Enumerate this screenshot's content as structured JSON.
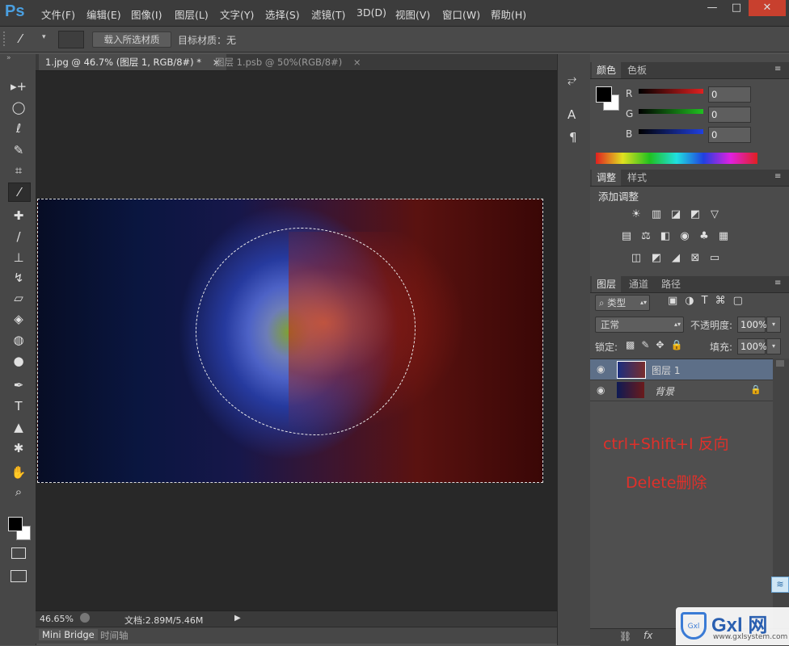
{
  "app": {
    "logo": "Ps"
  },
  "menubar": {
    "items": [
      "文件(F)",
      "编辑(E)",
      "图像(I)",
      "图层(L)",
      "文字(Y)",
      "选择(S)",
      "滤镜(T)",
      "3D(D)",
      "视图(V)",
      "窗口(W)",
      "帮助(H)"
    ],
    "minimize": "—",
    "maximize": "□",
    "close": "✕"
  },
  "options": {
    "load_button": "载入所选材质",
    "target_label": "目标材质：无"
  },
  "tools": [
    {
      "name": "move-tool-icon",
      "glyph": "▸+"
    },
    {
      "name": "ellipse-marquee-tool-icon",
      "glyph": "◯"
    },
    {
      "name": "lasso-tool-icon",
      "glyph": "ℓ"
    },
    {
      "name": "quick-selection-tool-icon",
      "glyph": "✎"
    },
    {
      "name": "crop-tool-icon",
      "glyph": "⌗"
    },
    {
      "name": "eyedropper-3d-tool-icon",
      "glyph": "⁄"
    },
    {
      "name": "healing-brush-tool-icon",
      "glyph": "✚"
    },
    {
      "name": "brush-tool-icon",
      "glyph": "/"
    },
    {
      "name": "clone-stamp-tool-icon",
      "glyph": "⊥"
    },
    {
      "name": "history-brush-tool-icon",
      "glyph": "↯"
    },
    {
      "name": "eraser-tool-icon",
      "glyph": "▱"
    },
    {
      "name": "paint-bucket-tool-icon",
      "glyph": "◈"
    },
    {
      "name": "blur-tool-icon",
      "glyph": "◍"
    },
    {
      "name": "dodge-tool-icon",
      "glyph": "●"
    },
    {
      "name": "pen-tool-icon",
      "glyph": "✒"
    },
    {
      "name": "type-tool-icon",
      "glyph": "T"
    },
    {
      "name": "path-selection-tool-icon",
      "glyph": "▲"
    },
    {
      "name": "custom-shape-tool-icon",
      "glyph": "✱"
    },
    {
      "name": "hand-tool-icon",
      "glyph": "✋"
    },
    {
      "name": "zoom-tool-icon",
      "glyph": "⌕"
    }
  ],
  "document": {
    "tabs": [
      {
        "label": "1.jpg @ 46.7% (图层 1, RGB/8#) *",
        "close": "×"
      },
      {
        "label": "图层 1.psb @ 50%(RGB/8#)",
        "close": "×"
      }
    ],
    "zoom": "46.65%",
    "doc_info": "文档:2.89M/5.46M"
  },
  "bottom_tabs": [
    "Mini Bridge",
    "时间轴"
  ],
  "color_panel": {
    "tabs": [
      "颜色",
      "色板"
    ],
    "channels": [
      {
        "label": "R",
        "value": "0",
        "color": "#e02020"
      },
      {
        "label": "G",
        "value": "0",
        "color": "#20c020"
      },
      {
        "label": "B",
        "value": "0",
        "color": "#2040e0"
      }
    ]
  },
  "adjust_panel": {
    "tabs": [
      "调整",
      "样式"
    ],
    "heading": "添加调整",
    "row1": [
      "☀",
      "▥",
      "◪",
      "◩",
      "▽"
    ],
    "row2": [
      "▤",
      "⚖",
      "◧",
      "◉",
      "♣",
      "▦"
    ],
    "row3": [
      "◫",
      "◩",
      "◢",
      "⊠",
      "▭"
    ]
  },
  "layers_panel": {
    "tabs": [
      "图层",
      "通道",
      "路径"
    ],
    "filter_kind": "类型",
    "blend_mode": "正常",
    "opacity_label": "不透明度:",
    "opacity_value": "100%",
    "lock_label": "锁定:",
    "fill_label": "填充:",
    "fill_value": "100%",
    "layers": [
      {
        "name": "图层 1",
        "selected": true
      },
      {
        "name": "背景",
        "selected": false,
        "locked": true
      }
    ]
  },
  "annotations": [
    "ctrl+Shift+I 反向",
    "Delete删除"
  ],
  "watermark": {
    "brand": "Gxl 网",
    "url": "www.gxlsystem.com"
  }
}
